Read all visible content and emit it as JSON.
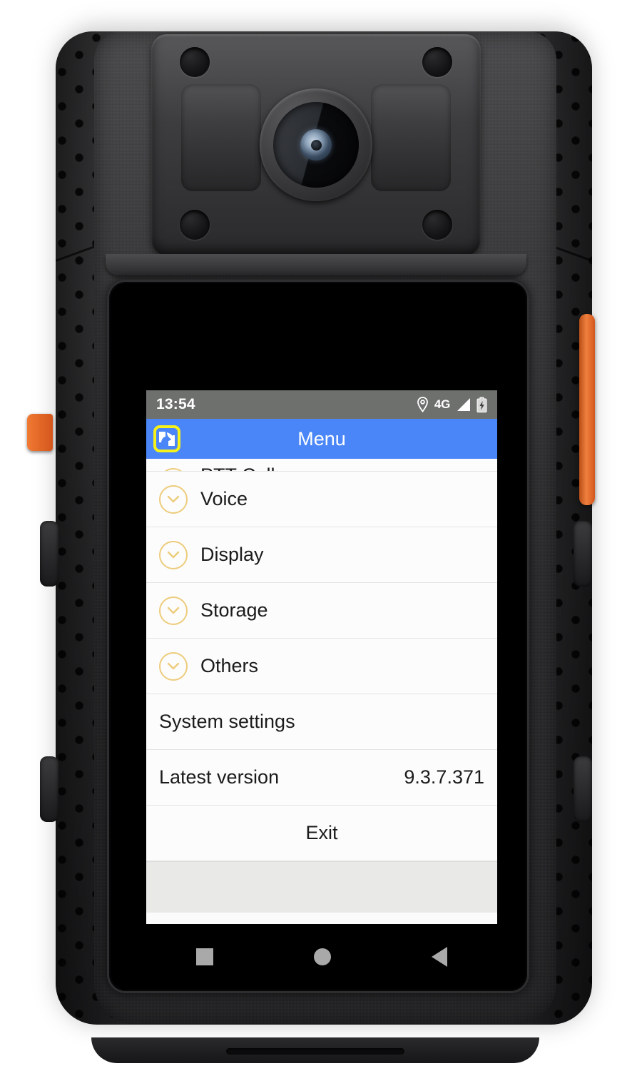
{
  "device": {
    "name": "body-worn-camera",
    "camera_label": "camera-lens",
    "side_button_left": "record-button",
    "side_button_right": "ptt-side-button"
  },
  "screen": {
    "statusbar": {
      "time": "13:54",
      "network": "4G",
      "icons": [
        "location-pin-icon",
        "signal-bars-icon",
        "battery-charging-icon"
      ]
    },
    "titlebar": {
      "title": "Menu",
      "app_icon": "app-logo-icon"
    },
    "list": [
      {
        "label": "PTT Call",
        "icon": "chevron-down-icon",
        "partial": true,
        "value": ""
      },
      {
        "label": "Voice",
        "icon": "chevron-down-icon",
        "partial": false,
        "value": ""
      },
      {
        "label": "Display",
        "icon": "chevron-down-icon",
        "partial": false,
        "value": ""
      },
      {
        "label": "Storage",
        "icon": "chevron-down-icon",
        "partial": false,
        "value": ""
      },
      {
        "label": "Others",
        "icon": "chevron-down-icon",
        "partial": false,
        "value": ""
      },
      {
        "label": "System settings",
        "icon": "",
        "partial": false,
        "value": ""
      },
      {
        "label": "Latest version",
        "icon": "",
        "partial": false,
        "value": "9.3.7.371"
      },
      {
        "label": "Exit",
        "icon": "",
        "partial": false,
        "value": ""
      }
    ],
    "navbar": {
      "recents": "recents-button",
      "home": "home-button",
      "back": "back-button"
    }
  },
  "colors": {
    "statusbar_bg": "#6e706e",
    "titlebar_bg": "#4a86f7",
    "app_icon_border": "#f5f119",
    "chevron_circle": "#edcc7c",
    "list_bg": "#fcfcfc",
    "filler_bg": "#e9eae8",
    "navbar_bg": "#000000",
    "nav_icon": "#a9a9a9",
    "accent_orange": "#ef7f3d"
  }
}
